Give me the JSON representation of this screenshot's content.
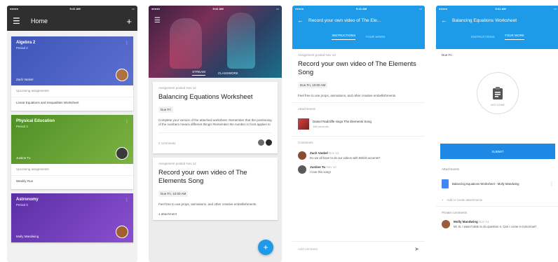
{
  "status": {
    "time": "9:41 AM"
  },
  "p1": {
    "title": "Home",
    "classes": [
      {
        "name": "Algebra 2",
        "period": "Period 2",
        "teacher": "Zach Vaskel",
        "upcoming_label": "Upcoming assignments",
        "assignment": "Linear Equations and Inequalities Worksheet",
        "color": "#3e55b8"
      },
      {
        "name": "Physical Education",
        "period": "Period 3",
        "teacher": "Justine Tu",
        "upcoming_label": "Upcoming assignments",
        "assignment": "Weekly Run",
        "color": "#5c9b2d"
      },
      {
        "name": "Astronomy",
        "period": "Period 3",
        "teacher": "Molly Mandwing",
        "upcoming_label": "",
        "assignment": "",
        "color": "#6b3fb5"
      }
    ]
  },
  "p2": {
    "tabs": [
      "STREAM",
      "CLASSWORK"
    ],
    "card1": {
      "posted": "Assignment posted Nov 12",
      "title": "Balancing Equations Worksheet",
      "due": "Due Fri",
      "body": "Complete your version of the attached worksheet. Remember that the positioning of the numbers means different things! Remember the number in front applies to",
      "comments": "2 comments"
    },
    "card2": {
      "posted": "Assignment posted Nov 12",
      "title": "Record your own video of The Elements Song",
      "due": "Due Fri, 10:00 AM",
      "body": "Feel free to use props, animations, and other creative embellishments.",
      "attachments": "1 attachment"
    },
    "fab": "+"
  },
  "p3": {
    "header_title": "Record your own video of The Ele...",
    "tabs": [
      "INSTRUCTIONS",
      "YOUR WORK"
    ],
    "posted": "Assignment posted Nov 12",
    "title": "Record your own video of The Elements Song",
    "due": "Due Fri, 10:00 AM",
    "body": "Feel free to use props, animations, and other creative embellishments.",
    "attachments_label": "Attachments",
    "attachment": {
      "title": "Daniel Radcliffe sings The Elements Song",
      "sub": "166 seconds"
    },
    "comments_label": "Comments",
    "comments": [
      {
        "name": "Zach Vaskel",
        "date": "Nov 12",
        "text": "Do we all have to do our videos with British accents?",
        "color": "#8a4b2f"
      },
      {
        "name": "Justine Tu",
        "date": "Nov 12",
        "text": "I love this song!",
        "color": "#5a5a5a"
      }
    ],
    "add_comment": "Add comment"
  },
  "p4": {
    "header_title": "Balancing Equations Worksheet",
    "tabs": [
      "INSTRUCTIONS",
      "YOUR WORK"
    ],
    "due": "Due Fri",
    "circle_caption": "NOT DONE",
    "submit": "SUBMIT",
    "attachments_label": "Attachments",
    "doc": "Balancing Equations Worksheet - Molly Mandwing",
    "add_attachment": "Add or create attachments",
    "private_label": "Private comments",
    "private_comment": {
      "name": "Molly Mandwing",
      "date": "Nov 14",
      "text": "Mr. B, I wasn't able to do question 4. Can I come in tomorrow?",
      "color": "#9b5a3c"
    }
  }
}
